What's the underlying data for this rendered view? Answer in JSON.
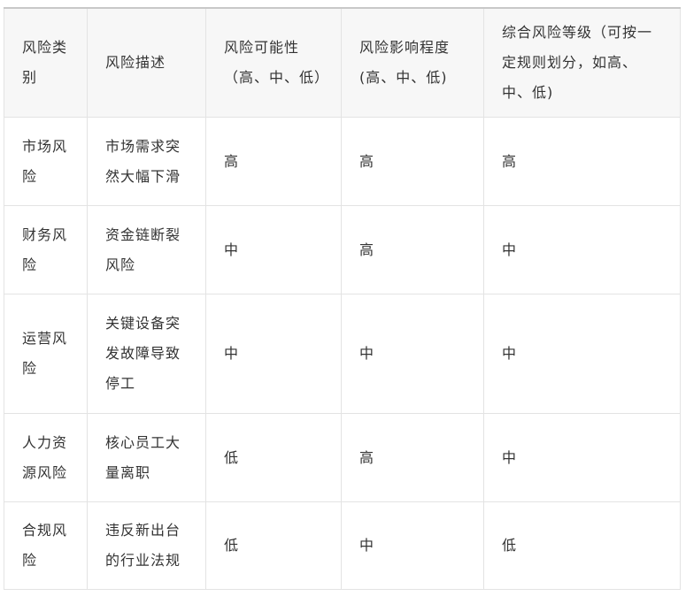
{
  "table": {
    "headers": [
      "风险类别",
      "风险描述",
      "风险可能性（高、中、低）",
      "风险影响程度(高、中、低)",
      "综合风险等级（可按一定规则划分，如高、中、低)"
    ],
    "rows": [
      [
        "市场风险",
        "市场需求突然大幅下滑",
        "高",
        "高",
        "高"
      ],
      [
        "财务风险",
        "资金链断裂风险",
        "中",
        "高",
        "中"
      ],
      [
        "运营风险",
        "关键设备突发故障导致停工",
        "中",
        "中",
        "中"
      ],
      [
        "人力资源风险",
        "核心员工大量离职",
        "低",
        "高",
        "中"
      ],
      [
        "合规风险",
        "违反新出台的行业法规",
        "低",
        "中",
        "低"
      ]
    ]
  }
}
